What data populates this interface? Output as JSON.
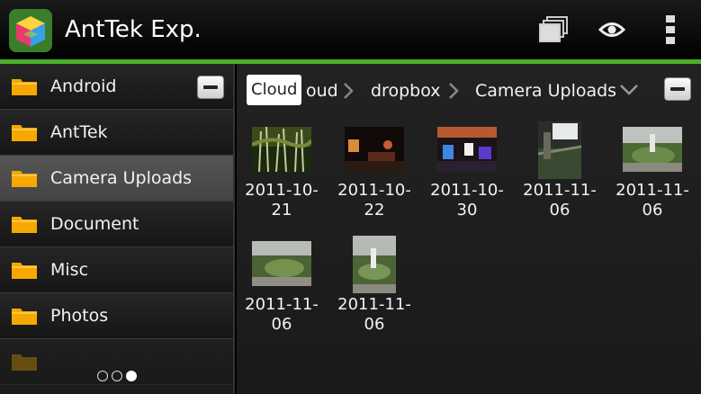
{
  "app": {
    "title": "AntTek Exp."
  },
  "actionbar": {
    "icons": [
      "windows-icon",
      "eye-icon",
      "overflow-menu-icon"
    ]
  },
  "sidebar": {
    "items": [
      {
        "label": "Android",
        "selected": false
      },
      {
        "label": "AntTek",
        "selected": false
      },
      {
        "label": "Camera Uploads",
        "selected": true
      },
      {
        "label": "Document",
        "selected": false
      },
      {
        "label": "Misc",
        "selected": false
      },
      {
        "label": "Photos",
        "selected": false
      }
    ],
    "page_indicator": {
      "pages": 3,
      "current": 3
    }
  },
  "breadcrumb": {
    "first": "Cloud",
    "partial": "oud",
    "items": [
      "dropbox",
      "Camera Uploads"
    ]
  },
  "files": [
    {
      "date_line1": "2011-10-",
      "date_line2": "21"
    },
    {
      "date_line1": "2011-10-",
      "date_line2": "22"
    },
    {
      "date_line1": "2011-10-",
      "date_line2": "30"
    },
    {
      "date_line1": "2011-11-",
      "date_line2": "06"
    },
    {
      "date_line1": "2011-11-",
      "date_line2": "06"
    },
    {
      "date_line1": "2011-11-",
      "date_line2": "06"
    },
    {
      "date_line1": "2011-11-",
      "date_line2": "06"
    }
  ],
  "colors": {
    "accent": "#4caf2a",
    "folder": "#f6a800"
  }
}
